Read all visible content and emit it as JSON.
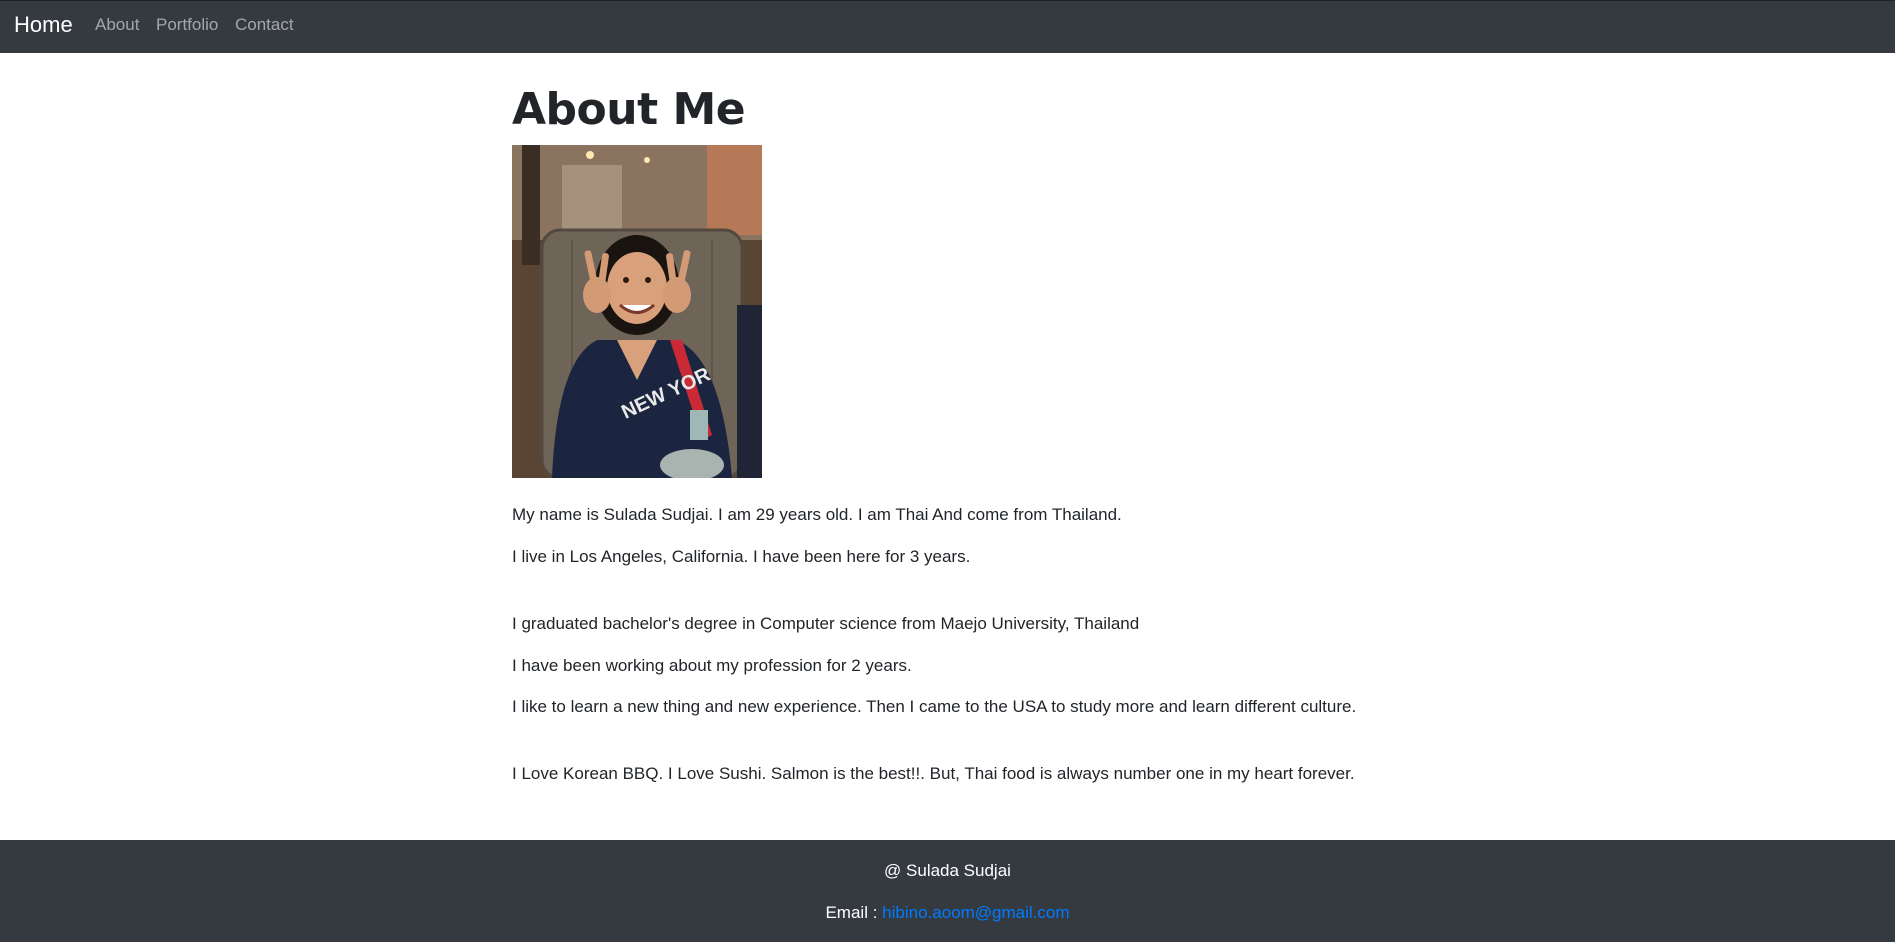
{
  "navbar": {
    "brand": "Home",
    "links": [
      "About",
      "Portfolio",
      "Contact"
    ]
  },
  "main": {
    "title": "About Me",
    "photo_alt": "profile-photo",
    "paragraphs": [
      "My name is Sulada Sudjai. I am 29 years old. I am Thai And come from Thailand.",
      "I live in Los Angeles, California. I have been here for 3 years.",
      "I graduated bachelor's degree in Computer science from Maejo University, Thailand",
      "I have been working about my profession for 2 years.",
      "I like to learn a new thing and new experience. Then I came to the USA to study more and learn different culture.",
      "I Love Korean BBQ. I Love Sushi. Salmon is the best!!. But, Thai food is always number one in my heart forever."
    ]
  },
  "footer": {
    "copyright": "@ Sulada Sudjai",
    "email_label": "Email :",
    "email": "hibino.aoom@gmail.com"
  },
  "colors": {
    "navbar_bg": "#343a40",
    "link": "#007bff"
  }
}
